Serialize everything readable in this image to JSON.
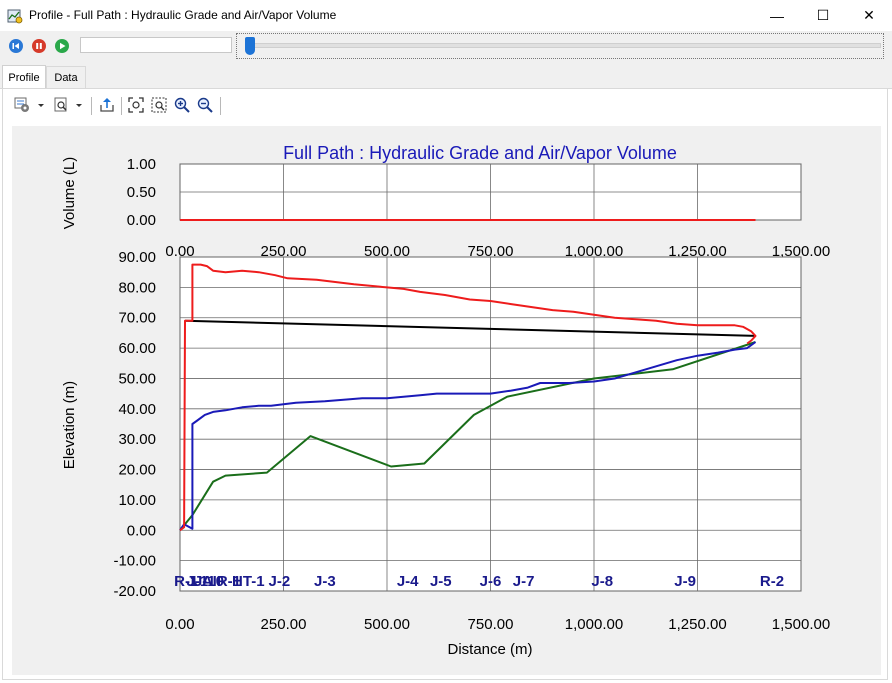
{
  "window": {
    "title": "Profile - Full Path : Hydraulic Grade and Air/Vapor Volume",
    "minimize_glyph": "—",
    "maximize_glyph": "☐",
    "close_glyph": "✕"
  },
  "playback": {
    "progress_text": "",
    "slider_fraction": 0.0
  },
  "tabs": [
    {
      "label": "Profile",
      "active": true
    },
    {
      "label": "Data",
      "active": false
    }
  ],
  "toolbar_icons": [
    "settings-icon",
    "dropdown-arrow-icon",
    "zoom-window-icon",
    "dropdown-arrow-icon",
    "export-icon",
    "zoom-extents-icon",
    "zoom-previous-icon",
    "zoom-in-icon",
    "zoom-out-icon"
  ],
  "colors": {
    "hgl": "#ee1c1c",
    "air_volume": "#ee1c1c",
    "pipe": "#1a1ab8",
    "ground": "#1a6e1a",
    "reference": "#000000",
    "title": "#1a1ab8",
    "node_label": "#1a1a8c"
  },
  "chart_data": [
    {
      "type": "line",
      "title": "Full Path : Hydraulic Grade and Air/Vapor Volume",
      "ylabel": "Volume (L)",
      "xlim": [
        0,
        1500
      ],
      "ylim": [
        0,
        1
      ],
      "yticks": [
        "0.00",
        "0.50",
        "1.00"
      ],
      "xticks": [
        "0.00",
        "250.00",
        "500.00",
        "750.00",
        "1,000.00",
        "1,250.00",
        "1,500.00"
      ],
      "series": [
        {
          "key": "air_volume",
          "x": [
            0,
            1390
          ],
          "y": [
            0,
            0
          ]
        }
      ]
    },
    {
      "type": "line",
      "xlabel": "Distance (m)",
      "ylabel": "Elevation (m)",
      "xlim": [
        0,
        1500
      ],
      "ylim": [
        -20,
        90
      ],
      "xticks": [
        "0.00",
        "250.00",
        "500.00",
        "750.00",
        "1,000.00",
        "1,250.00",
        "1,500.00"
      ],
      "yticks": [
        "-20.00",
        "-10.00",
        "0.00",
        "10.00",
        "20.00",
        "30.00",
        "40.00",
        "50.00",
        "60.00",
        "70.00",
        "80.00",
        "90.00"
      ],
      "series": [
        {
          "key": "hgl",
          "x": [
            0,
            10,
            12,
            30,
            30,
            45,
            50,
            65,
            80,
            110,
            150,
            190,
            230,
            260,
            330,
            360,
            420,
            500,
            540,
            580,
            640,
            700,
            750,
            800,
            850,
            900,
            950,
            1000,
            1050,
            1100,
            1150,
            1200,
            1250,
            1300,
            1340,
            1360,
            1380,
            1390,
            1380,
            1370
          ],
          "y": [
            0,
            1,
            69,
            69,
            87.5,
            87.5,
            87.5,
            87,
            85.5,
            85,
            85.5,
            85,
            84,
            83,
            82.5,
            82,
            81,
            80,
            79.5,
            78.5,
            77.5,
            76,
            75.5,
            74.5,
            73.5,
            72.5,
            72,
            71,
            70,
            69.5,
            69,
            68,
            67.5,
            67.5,
            67.5,
            67,
            65.5,
            64,
            62.5,
            61.5
          ]
        },
        {
          "key": "pipe",
          "x": [
            0,
            10,
            30,
            30,
            40,
            60,
            80,
            110,
            150,
            190,
            220,
            280,
            350,
            440,
            500,
            540,
            580,
            620,
            700,
            750,
            800,
            840,
            870,
            900,
            940,
            1000,
            1050,
            1100,
            1150,
            1200,
            1250,
            1300,
            1340,
            1370,
            1390
          ],
          "y": [
            0,
            2,
            0.5,
            35,
            36,
            38,
            39,
            39.5,
            40.5,
            41,
            41,
            42,
            42.5,
            43.5,
            43.5,
            44,
            44.5,
            45,
            45,
            45,
            46,
            47,
            48.5,
            48.5,
            48.5,
            49,
            50,
            52,
            54,
            56,
            57.5,
            58.5,
            59.5,
            60,
            62
          ]
        },
        {
          "key": "ground",
          "x": [
            0,
            30,
            80,
            110,
            210,
            315,
            510,
            590,
            710,
            790,
            1000,
            1190,
            1390
          ],
          "y": [
            0,
            5,
            16,
            18,
            19,
            31,
            21,
            22,
            38,
            44,
            50,
            53,
            62
          ]
        },
        {
          "key": "reference",
          "x": [
            12,
            1390
          ],
          "y": [
            69,
            64
          ]
        }
      ],
      "node_labels": [
        {
          "text": "R-1",
          "x": 15
        },
        {
          "text": "J-1",
          "x": 42
        },
        {
          "text": "J-10",
          "x": 70
        },
        {
          "text": "AIR-1",
          "x": 100
        },
        {
          "text": "HT-1",
          "x": 165
        },
        {
          "text": "J-2",
          "x": 240
        },
        {
          "text": "J-3",
          "x": 350
        },
        {
          "text": "J-4",
          "x": 550
        },
        {
          "text": "J-5",
          "x": 630
        },
        {
          "text": "J-6",
          "x": 750
        },
        {
          "text": "J-7",
          "x": 830
        },
        {
          "text": "J-8",
          "x": 1020
        },
        {
          "text": "J-9",
          "x": 1220
        },
        {
          "text": "R-2",
          "x": 1430
        }
      ]
    }
  ]
}
